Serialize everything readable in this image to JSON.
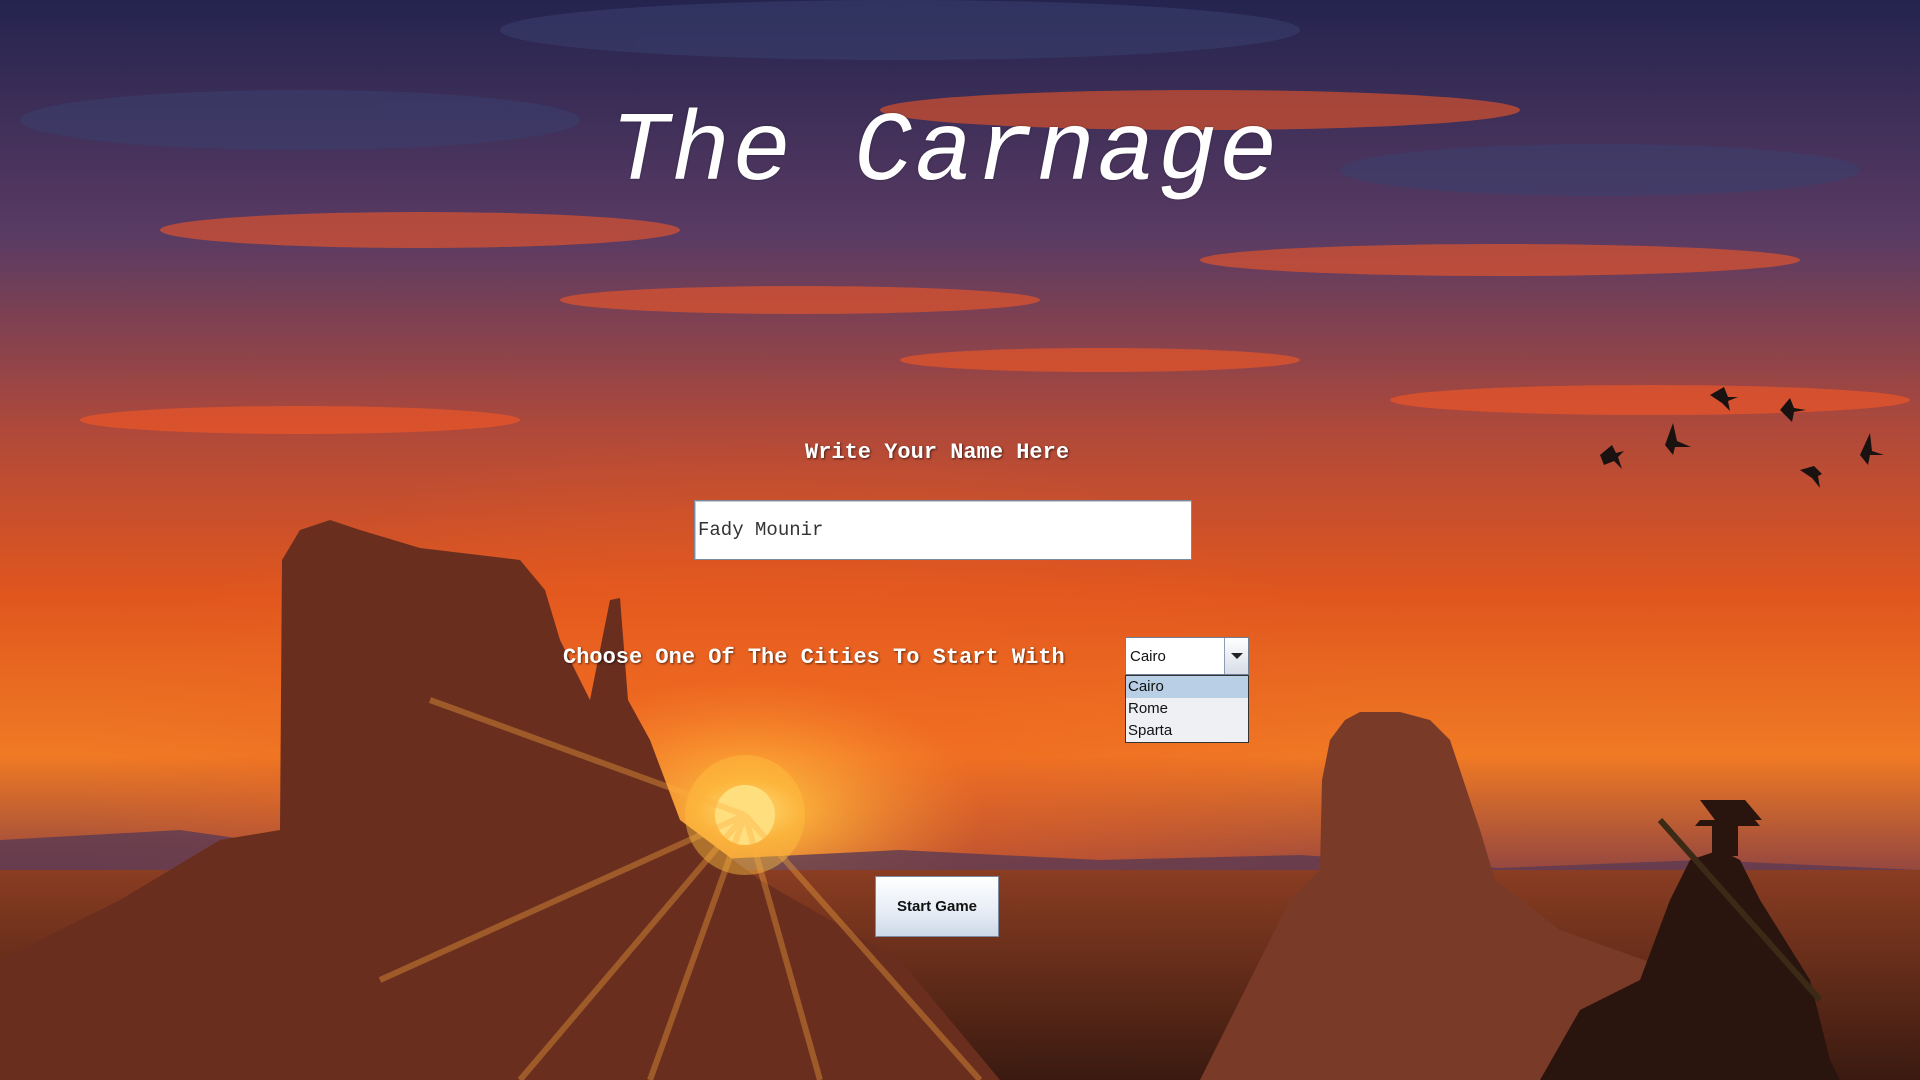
{
  "game": {
    "title": "The Carnage"
  },
  "form": {
    "name_label": "Write Your Name Here",
    "name_value": "Fady Mounir",
    "city_label": "Choose One Of The Cities To Start With",
    "city_selected": "Cairo",
    "city_options": [
      "Cairo",
      "Rome",
      "Sparta"
    ],
    "start_label": "Start Game"
  },
  "colors": {
    "sky_top": "#2a2a55",
    "sky_glow": "#e0521a",
    "sun": "#ffd23a",
    "ground": "#6e2f1c",
    "text": "#ffffff"
  }
}
